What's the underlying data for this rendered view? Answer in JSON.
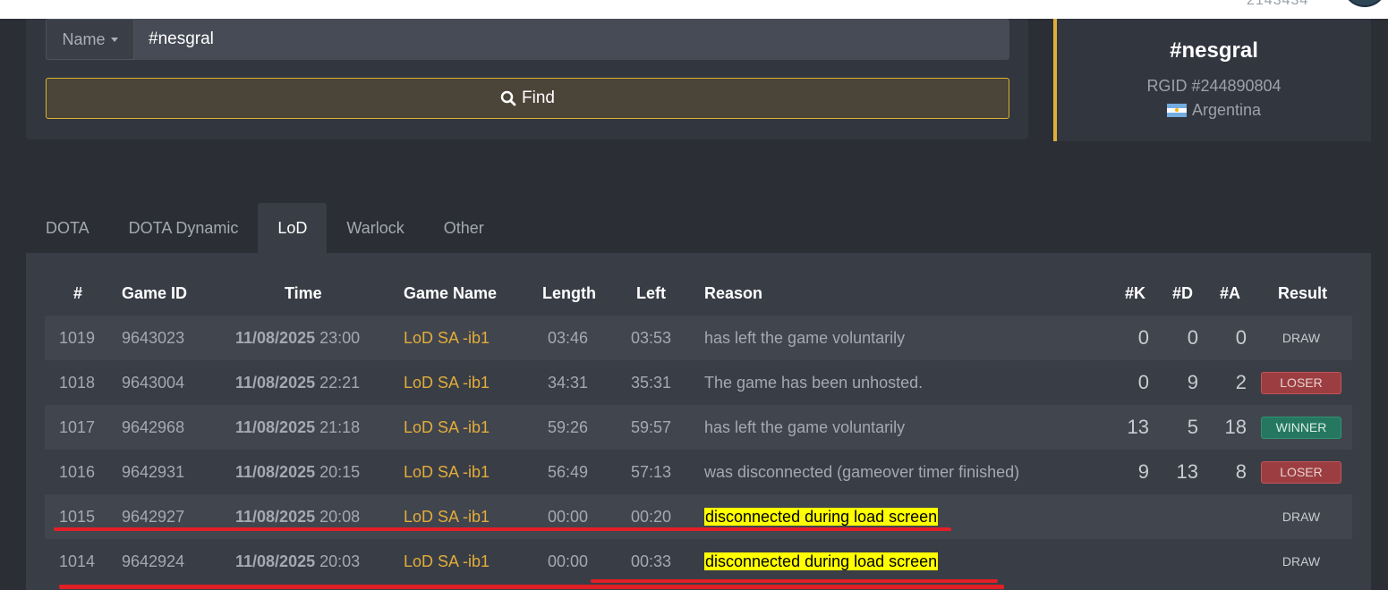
{
  "top_bar": {
    "clipped_text": "2143434",
    "accent": "#ffffff"
  },
  "search": {
    "filter_label": "Name",
    "query_value": "#nesgral",
    "find_label": "Find"
  },
  "profile": {
    "name": "#nesgral",
    "rgid": "RGID #244890804",
    "country": "Argentina",
    "accent_color": "#e2ad3a"
  },
  "tabs": [
    {
      "label": "DOTA",
      "active": false
    },
    {
      "label": "DOTA Dynamic",
      "active": false
    },
    {
      "label": "LoD",
      "active": true
    },
    {
      "label": "Warlock",
      "active": false
    },
    {
      "label": "Other",
      "active": false
    }
  ],
  "table": {
    "headers": {
      "num": "#",
      "game_id": "Game ID",
      "time": "Time",
      "game_name": "Game Name",
      "length": "Length",
      "left": "Left",
      "reason": "Reason",
      "k": "#K",
      "d": "#D",
      "a": "#A",
      "result": "Result"
    },
    "rows": [
      {
        "num": "1019",
        "game_id": "9643023",
        "date": "11/08/2025",
        "clock": "23:00",
        "game_name": "LoD SA -ib1",
        "length": "03:46",
        "left": "03:53",
        "reason": "has left the game voluntarily",
        "highlight": false,
        "k": "0",
        "d": "0",
        "a": "0",
        "result": "DRAW"
      },
      {
        "num": "1018",
        "game_id": "9643004",
        "date": "11/08/2025",
        "clock": "22:21",
        "game_name": "LoD SA -ib1",
        "length": "34:31",
        "left": "35:31",
        "reason": "The game has been unhosted.",
        "highlight": false,
        "k": "0",
        "d": "9",
        "a": "2",
        "result": "LOSER"
      },
      {
        "num": "1017",
        "game_id": "9642968",
        "date": "11/08/2025",
        "clock": "21:18",
        "game_name": "LoD SA -ib1",
        "length": "59:26",
        "left": "59:57",
        "reason": "has left the game voluntarily",
        "highlight": false,
        "k": "13",
        "d": "5",
        "a": "18",
        "result": "WINNER"
      },
      {
        "num": "1016",
        "game_id": "9642931",
        "date": "11/08/2025",
        "clock": "20:15",
        "game_name": "LoD SA -ib1",
        "length": "56:49",
        "left": "57:13",
        "reason": "was disconnected (gameover timer finished)",
        "highlight": false,
        "k": "9",
        "d": "13",
        "a": "8",
        "result": "LOSER"
      },
      {
        "num": "1015",
        "game_id": "9642927",
        "date": "11/08/2025",
        "clock": "20:08",
        "game_name": "LoD SA -ib1",
        "length": "00:00",
        "left": "00:20",
        "reason": "disconnected during load screen",
        "highlight": true,
        "k": "",
        "d": "",
        "a": "",
        "result": "DRAW"
      },
      {
        "num": "1014",
        "game_id": "9642924",
        "date": "11/08/2025",
        "clock": "20:03",
        "game_name": "LoD SA -ib1",
        "length": "00:00",
        "left": "00:33",
        "reason": "disconnected during load screen",
        "highlight": true,
        "k": "",
        "d": "",
        "a": "",
        "result": "DRAW"
      }
    ]
  },
  "colors": {
    "loser": "#9c3e41",
    "winner": "#26775f",
    "highlight": "#ffff00",
    "annotation": "#e21f26"
  }
}
